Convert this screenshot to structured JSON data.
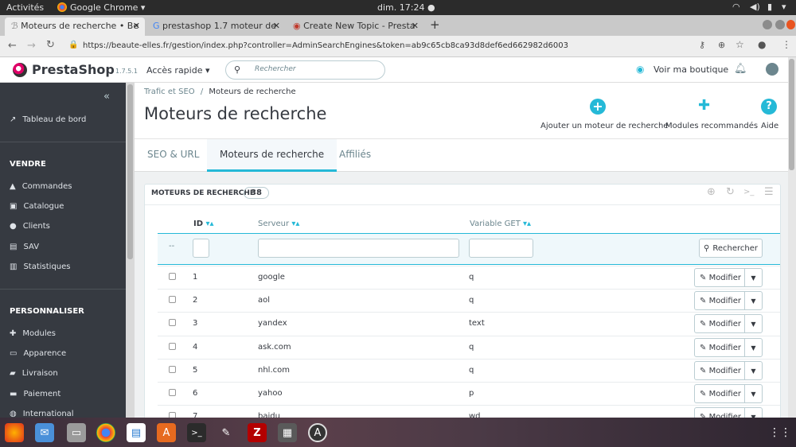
{
  "topbar": {
    "activities": "Activités",
    "app": "Google Chrome ▾",
    "clock": "dim. 17:24 ●"
  },
  "tabs": [
    {
      "label": "Moteurs de recherche • Be",
      "close": "✕"
    },
    {
      "label": "prestashop 1.7 moteur de",
      "close": "✕"
    },
    {
      "label": "Create New Topic - Presta",
      "close": "✕"
    }
  ],
  "address": {
    "url": "https://beaute-elles.fr/gestion/index.php?controller=AdminSearchEngines&token=ab9c65cb8ca93d8def6ed662982d6003"
  },
  "header": {
    "brand": "PrestaShop",
    "version": "1.7.5.1",
    "quick": "Accès rapide ▾",
    "search_placeholder": "Rechercher",
    "view_shop": "Voir ma boutique"
  },
  "sidebar": {
    "dashboard": "Tableau de bord",
    "sell_title": "VENDRE",
    "sell": [
      "Commandes",
      "Catalogue",
      "Clients",
      "SAV",
      "Statistiques"
    ],
    "custom_title": "PERSONNALISER",
    "custom": [
      "Modules",
      "Apparence",
      "Livraison",
      "Paiement",
      "International"
    ]
  },
  "page": {
    "breadcrumb_parent": "Trafic et SEO",
    "breadcrumb_sep": "/",
    "breadcrumb_current": "Moteurs de recherche",
    "title": "Moteurs de recherche",
    "actions": [
      "Ajouter un moteur de recherche",
      "Modules recommandés",
      "Aide"
    ]
  },
  "page_tabs": [
    "SEO & URL",
    "Moteurs de recherche",
    "Affiliés"
  ],
  "panel": {
    "title": "MOTEURS DE RECHERCHE",
    "count": "38",
    "columns": [
      "ID",
      "Serveur",
      "Variable GET"
    ],
    "filter_dash": "--",
    "search_btn": "Rechercher",
    "row_btn": "Modifier",
    "rows": [
      {
        "id": "1",
        "server": "google",
        "var": "q"
      },
      {
        "id": "2",
        "server": "aol",
        "var": "q"
      },
      {
        "id": "3",
        "server": "yandex",
        "var": "text"
      },
      {
        "id": "4",
        "server": "ask.com",
        "var": "q"
      },
      {
        "id": "5",
        "server": "nhl.com",
        "var": "q"
      },
      {
        "id": "6",
        "server": "yahoo",
        "var": "p"
      },
      {
        "id": "7",
        "server": "baidu",
        "var": "wd"
      }
    ]
  },
  "colors": {
    "accent": "#25b9d7",
    "sidebar": "#363a41"
  }
}
